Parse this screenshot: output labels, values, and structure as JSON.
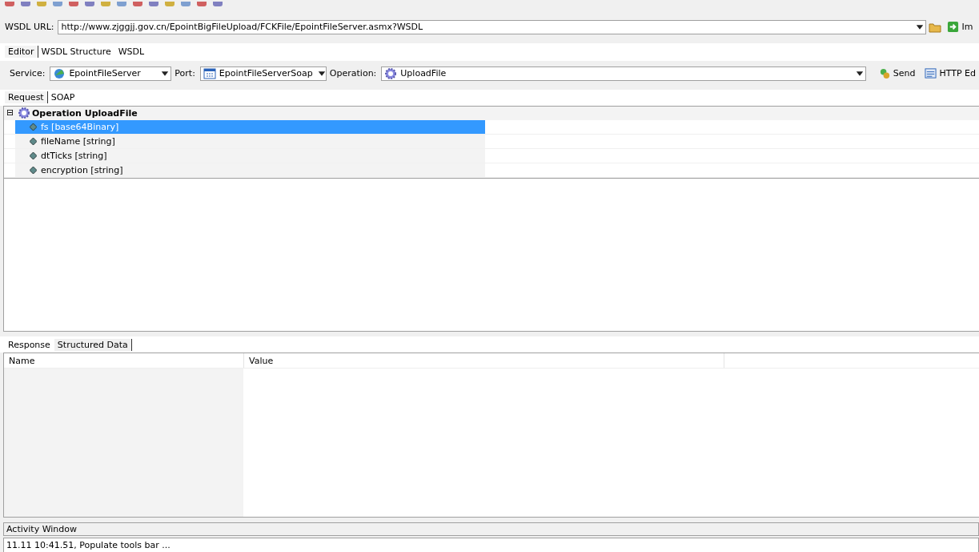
{
  "wsdl_url": {
    "label": "WSDL URL:",
    "value": "http://www.zjggjj.gov.cn/EpointBigFileUpload/FCKFile/EpointFileServer.asmx?WSDL",
    "import_label": "Im"
  },
  "tabs": [
    {
      "label": "Editor",
      "selected": true
    },
    {
      "label": "WSDL Structure",
      "selected": false
    },
    {
      "label": "WSDL",
      "selected": false
    }
  ],
  "service": {
    "label": "Service:",
    "value": "EpointFileServer"
  },
  "port": {
    "label": "Port:",
    "value": "EpointFileServerSoap"
  },
  "operation": {
    "label": "Operation:",
    "value": "UploadFile"
  },
  "send_label": "Send",
  "http_label": "HTTP Ed",
  "request_tabs": [
    {
      "label": "Request",
      "selected": true
    },
    {
      "label": "SOAP",
      "selected": false
    }
  ],
  "tree": {
    "label": "Operation UploadFile",
    "expanded": true,
    "expander": "⊟",
    "children": [
      {
        "label": "fs [base64Binary]",
        "selected": true
      },
      {
        "label": "fileName [string]",
        "selected": false
      },
      {
        "label": "dtTicks [string]",
        "selected": false
      },
      {
        "label": "encryption [string]",
        "selected": false
      }
    ]
  },
  "response_tabs": [
    {
      "label": "Response",
      "selected": false
    },
    {
      "label": "Structured Data",
      "selected": true
    }
  ],
  "response_table": {
    "columns": [
      "Name",
      "Value"
    ]
  },
  "activity": {
    "title": "Activity Window",
    "lines": [
      "11.11 10:41.51, Populate tools bar ..."
    ]
  }
}
